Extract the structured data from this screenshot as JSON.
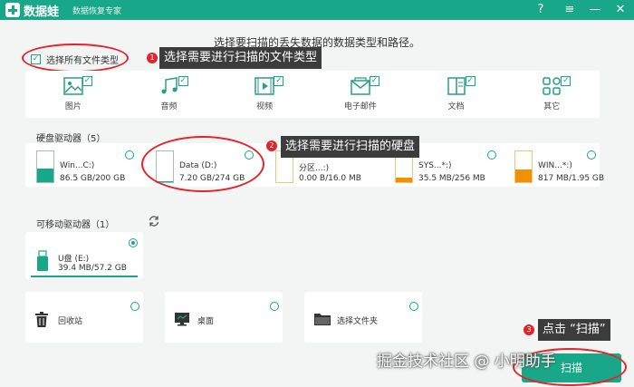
{
  "app": {
    "name": "数据蛙",
    "subtitle": "数据恢复专家",
    "window_buttons": [
      "?",
      "≡",
      "—",
      "✕"
    ]
  },
  "headline": "选择要扫描的丢失数据的数据类型和路径。",
  "select_all": {
    "label": "选择所有文件类型",
    "checked": true
  },
  "file_types": [
    {
      "label": "图片",
      "icon": "image-icon",
      "checked": true
    },
    {
      "label": "音频",
      "icon": "music-icon",
      "checked": true
    },
    {
      "label": "视频",
      "icon": "video-icon",
      "checked": true
    },
    {
      "label": "电子邮件",
      "icon": "email-icon",
      "checked": true
    },
    {
      "label": "文档",
      "icon": "document-icon",
      "checked": true
    },
    {
      "label": "其它",
      "icon": "other-icon",
      "checked": true
    }
  ],
  "hard_drives": {
    "title": "硬盘驱动器（5）",
    "items": [
      {
        "name": "Win...C:)",
        "size": "86.5 GB/200 GB",
        "usage": 0.43,
        "color": "#18a889",
        "selected": false
      },
      {
        "name": "Data (D:)",
        "size": "7.20 GB/274 GB",
        "usage": 0.03,
        "color": "#18a889",
        "selected": false
      },
      {
        "name": "分区...:)",
        "size": "0.00  B/16.0 MB",
        "usage": 0.0,
        "color": "#f29100",
        "selected": false
      },
      {
        "name": "SYS...*:)",
        "size": "35.5 MB/256 MB",
        "usage": 0.14,
        "color": "#f29100",
        "selected": false
      },
      {
        "name": "WIN...*:)",
        "size": "817 MB/1.95 GB",
        "usage": 0.42,
        "color": "#f29100",
        "selected": false
      }
    ]
  },
  "removable": {
    "title": "可移动驱动器（1）",
    "items": [
      {
        "name": "U盘 (E:)",
        "size": "39.4 MB/57.2 GB",
        "usage": 0.001,
        "selected": true
      }
    ]
  },
  "locations": [
    {
      "label": "回收站",
      "icon": "recycle-bin-icon"
    },
    {
      "label": "桌面",
      "icon": "desktop-icon"
    },
    {
      "label": "选择文件夹",
      "icon": "folder-icon"
    }
  ],
  "callouts": [
    {
      "num": "1",
      "text": "选择需要进行扫描的文件类型"
    },
    {
      "num": "2",
      "text": "选择需要进行扫描的硬盘"
    },
    {
      "num": "3",
      "text": "点击 “扫描”"
    }
  ],
  "scan_button": "扫描",
  "watermark": "掘金技术社区 @ 小明助手",
  "colors": {
    "accent": "#18a889",
    "warning": "#f29100",
    "annotation": "#e3242b"
  }
}
